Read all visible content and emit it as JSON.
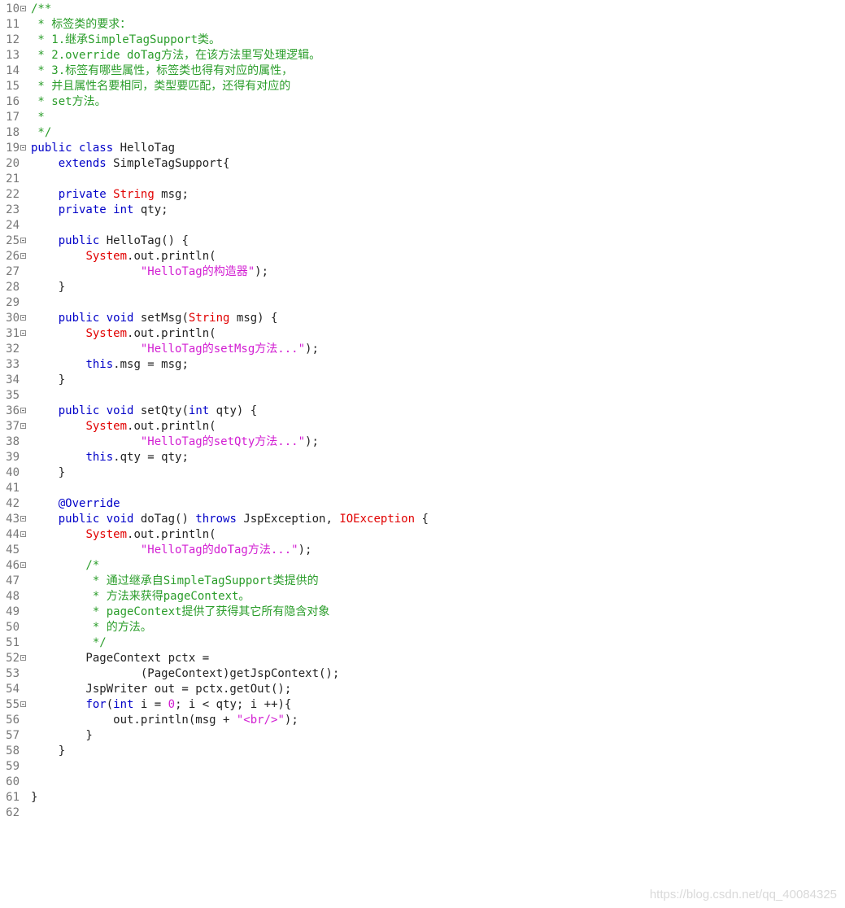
{
  "editor": {
    "lines": [
      {
        "num": "10",
        "fold": true,
        "tokens": [
          {
            "t": "/**",
            "c": "cm"
          }
        ]
      },
      {
        "num": "11",
        "fold": false,
        "tokens": [
          {
            "t": " * 标签类的要求：",
            "c": "cm"
          }
        ]
      },
      {
        "num": "12",
        "fold": false,
        "tokens": [
          {
            "t": " * 1.继承SimpleTagSupport类。",
            "c": "cm"
          }
        ]
      },
      {
        "num": "13",
        "fold": false,
        "tokens": [
          {
            "t": " * 2.override doTag方法，在该方法里写处理逻辑。",
            "c": "cm"
          }
        ]
      },
      {
        "num": "14",
        "fold": false,
        "tokens": [
          {
            "t": " * 3.标签有哪些属性，标签类也得有对应的属性，",
            "c": "cm"
          }
        ]
      },
      {
        "num": "15",
        "fold": false,
        "tokens": [
          {
            "t": " * 并且属性名要相同，类型要匹配，还得有对应的",
            "c": "cm"
          }
        ]
      },
      {
        "num": "16",
        "fold": false,
        "tokens": [
          {
            "t": " * set方法。",
            "c": "cm"
          }
        ]
      },
      {
        "num": "17",
        "fold": false,
        "tokens": [
          {
            "t": " *",
            "c": "cm"
          }
        ]
      },
      {
        "num": "18",
        "fold": false,
        "tokens": [
          {
            "t": " */",
            "c": "cm"
          }
        ]
      },
      {
        "num": "19",
        "fold": true,
        "tokens": [
          {
            "t": "public",
            "c": "kw"
          },
          {
            "t": " ",
            "c": "pl"
          },
          {
            "t": "class",
            "c": "kw"
          },
          {
            "t": " HelloTag",
            "c": "pl"
          }
        ]
      },
      {
        "num": "20",
        "fold": false,
        "tokens": [
          {
            "t": "    ",
            "c": "pl"
          },
          {
            "t": "extends",
            "c": "kw"
          },
          {
            "t": " SimpleTagSupport{",
            "c": "pl"
          }
        ]
      },
      {
        "num": "21",
        "fold": false,
        "tokens": []
      },
      {
        "num": "22",
        "fold": false,
        "tokens": [
          {
            "t": "    ",
            "c": "pl"
          },
          {
            "t": "private",
            "c": "kw"
          },
          {
            "t": " ",
            "c": "pl"
          },
          {
            "t": "String",
            "c": "typ"
          },
          {
            "t": " msg;",
            "c": "pl"
          }
        ]
      },
      {
        "num": "23",
        "fold": false,
        "tokens": [
          {
            "t": "    ",
            "c": "pl"
          },
          {
            "t": "private",
            "c": "kw"
          },
          {
            "t": " ",
            "c": "pl"
          },
          {
            "t": "int",
            "c": "kw"
          },
          {
            "t": " qty;",
            "c": "pl"
          }
        ]
      },
      {
        "num": "24",
        "fold": false,
        "tokens": []
      },
      {
        "num": "25",
        "fold": true,
        "tokens": [
          {
            "t": "    ",
            "c": "pl"
          },
          {
            "t": "public",
            "c": "kw"
          },
          {
            "t": " HelloTag() {",
            "c": "pl"
          }
        ]
      },
      {
        "num": "26",
        "fold": true,
        "tokens": [
          {
            "t": "        ",
            "c": "pl"
          },
          {
            "t": "System",
            "c": "typ"
          },
          {
            "t": ".out.println(",
            "c": "pl"
          }
        ]
      },
      {
        "num": "27",
        "fold": false,
        "tokens": [
          {
            "t": "                ",
            "c": "pl"
          },
          {
            "t": "\"HelloTag的构造器\"",
            "c": "str"
          },
          {
            "t": ");",
            "c": "pl"
          }
        ]
      },
      {
        "num": "28",
        "fold": false,
        "tokens": [
          {
            "t": "    }",
            "c": "pl"
          }
        ]
      },
      {
        "num": "29",
        "fold": false,
        "tokens": []
      },
      {
        "num": "30",
        "fold": true,
        "tokens": [
          {
            "t": "    ",
            "c": "pl"
          },
          {
            "t": "public",
            "c": "kw"
          },
          {
            "t": " ",
            "c": "pl"
          },
          {
            "t": "void",
            "c": "kw"
          },
          {
            "t": " setMsg(",
            "c": "pl"
          },
          {
            "t": "String",
            "c": "typ"
          },
          {
            "t": " msg) {",
            "c": "pl"
          }
        ]
      },
      {
        "num": "31",
        "fold": true,
        "tokens": [
          {
            "t": "        ",
            "c": "pl"
          },
          {
            "t": "System",
            "c": "typ"
          },
          {
            "t": ".out.println(",
            "c": "pl"
          }
        ]
      },
      {
        "num": "32",
        "fold": false,
        "tokens": [
          {
            "t": "                ",
            "c": "pl"
          },
          {
            "t": "\"HelloTag的setMsg方法...\"",
            "c": "str"
          },
          {
            "t": ");",
            "c": "pl"
          }
        ]
      },
      {
        "num": "33",
        "fold": false,
        "tokens": [
          {
            "t": "        ",
            "c": "pl"
          },
          {
            "t": "this",
            "c": "kw"
          },
          {
            "t": ".msg = msg;",
            "c": "pl"
          }
        ]
      },
      {
        "num": "34",
        "fold": false,
        "tokens": [
          {
            "t": "    }",
            "c": "pl"
          }
        ]
      },
      {
        "num": "35",
        "fold": false,
        "tokens": []
      },
      {
        "num": "36",
        "fold": true,
        "tokens": [
          {
            "t": "    ",
            "c": "pl"
          },
          {
            "t": "public",
            "c": "kw"
          },
          {
            "t": " ",
            "c": "pl"
          },
          {
            "t": "void",
            "c": "kw"
          },
          {
            "t": " setQty(",
            "c": "pl"
          },
          {
            "t": "int",
            "c": "kw"
          },
          {
            "t": " qty) {",
            "c": "pl"
          }
        ]
      },
      {
        "num": "37",
        "fold": true,
        "tokens": [
          {
            "t": "        ",
            "c": "pl"
          },
          {
            "t": "System",
            "c": "typ"
          },
          {
            "t": ".out.println(",
            "c": "pl"
          }
        ]
      },
      {
        "num": "38",
        "fold": false,
        "tokens": [
          {
            "t": "                ",
            "c": "pl"
          },
          {
            "t": "\"HelloTag的setQty方法...\"",
            "c": "str"
          },
          {
            "t": ");",
            "c": "pl"
          }
        ]
      },
      {
        "num": "39",
        "fold": false,
        "tokens": [
          {
            "t": "        ",
            "c": "pl"
          },
          {
            "t": "this",
            "c": "kw"
          },
          {
            "t": ".qty = qty;",
            "c": "pl"
          }
        ]
      },
      {
        "num": "40",
        "fold": false,
        "tokens": [
          {
            "t": "    }",
            "c": "pl"
          }
        ]
      },
      {
        "num": "41",
        "fold": false,
        "tokens": []
      },
      {
        "num": "42",
        "fold": false,
        "tokens": [
          {
            "t": "    ",
            "c": "pl"
          },
          {
            "t": "@Override",
            "c": "ann"
          }
        ]
      },
      {
        "num": "43",
        "fold": true,
        "tokens": [
          {
            "t": "    ",
            "c": "pl"
          },
          {
            "t": "public",
            "c": "kw"
          },
          {
            "t": " ",
            "c": "pl"
          },
          {
            "t": "void",
            "c": "kw"
          },
          {
            "t": " doTag() ",
            "c": "pl"
          },
          {
            "t": "throws",
            "c": "kw"
          },
          {
            "t": " JspException, ",
            "c": "pl"
          },
          {
            "t": "IOException",
            "c": "typ"
          },
          {
            "t": " {",
            "c": "pl"
          }
        ]
      },
      {
        "num": "44",
        "fold": true,
        "tokens": [
          {
            "t": "        ",
            "c": "pl"
          },
          {
            "t": "System",
            "c": "typ"
          },
          {
            "t": ".out.println(",
            "c": "pl"
          }
        ]
      },
      {
        "num": "45",
        "fold": false,
        "tokens": [
          {
            "t": "                ",
            "c": "pl"
          },
          {
            "t": "\"HelloTag的doTag方法...\"",
            "c": "str"
          },
          {
            "t": ");",
            "c": "pl"
          }
        ]
      },
      {
        "num": "46",
        "fold": true,
        "tokens": [
          {
            "t": "        /*",
            "c": "cm"
          }
        ]
      },
      {
        "num": "47",
        "fold": false,
        "tokens": [
          {
            "t": "         * 通过继承自SimpleTagSupport类提供的",
            "c": "cm"
          }
        ]
      },
      {
        "num": "48",
        "fold": false,
        "tokens": [
          {
            "t": "         * 方法来获得pageContext。",
            "c": "cm"
          }
        ]
      },
      {
        "num": "49",
        "fold": false,
        "tokens": [
          {
            "t": "         * pageContext提供了获得其它所有隐含对象",
            "c": "cm"
          }
        ]
      },
      {
        "num": "50",
        "fold": false,
        "tokens": [
          {
            "t": "         * 的方法。",
            "c": "cm"
          }
        ]
      },
      {
        "num": "51",
        "fold": false,
        "tokens": [
          {
            "t": "         */",
            "c": "cm"
          }
        ]
      },
      {
        "num": "52",
        "fold": true,
        "tokens": [
          {
            "t": "        PageContext pctx =",
            "c": "pl"
          }
        ]
      },
      {
        "num": "53",
        "fold": false,
        "tokens": [
          {
            "t": "                (PageContext)getJspContext();",
            "c": "pl"
          }
        ]
      },
      {
        "num": "54",
        "fold": false,
        "tokens": [
          {
            "t": "        JspWriter out = pctx.getOut();",
            "c": "pl"
          }
        ]
      },
      {
        "num": "55",
        "fold": true,
        "tokens": [
          {
            "t": "        ",
            "c": "pl"
          },
          {
            "t": "for",
            "c": "kw"
          },
          {
            "t": "(",
            "c": "pl"
          },
          {
            "t": "int",
            "c": "kw"
          },
          {
            "t": " i = ",
            "c": "pl"
          },
          {
            "t": "0",
            "c": "num"
          },
          {
            "t": "; i < qty; i ++){",
            "c": "pl"
          }
        ]
      },
      {
        "num": "56",
        "fold": false,
        "tokens": [
          {
            "t": "            out.println(msg + ",
            "c": "pl"
          },
          {
            "t": "\"<br/>\"",
            "c": "str"
          },
          {
            "t": ");",
            "c": "pl"
          }
        ]
      },
      {
        "num": "57",
        "fold": false,
        "tokens": [
          {
            "t": "        }",
            "c": "pl"
          }
        ]
      },
      {
        "num": "58",
        "fold": false,
        "tokens": [
          {
            "t": "    }",
            "c": "pl"
          }
        ]
      },
      {
        "num": "59",
        "fold": false,
        "tokens": []
      },
      {
        "num": "60",
        "fold": false,
        "tokens": []
      },
      {
        "num": "61",
        "fold": false,
        "tokens": [
          {
            "t": "}",
            "c": "pl"
          }
        ]
      },
      {
        "num": "62",
        "fold": false,
        "tokens": []
      }
    ]
  },
  "watermark": "https://blog.csdn.net/qq_40084325",
  "colors": {
    "keyword": "#0000c8",
    "comment": "#2a9d2a",
    "string": "#d21ed2",
    "type": "#e10000",
    "plain": "#222222",
    "line_number": "#787878"
  }
}
